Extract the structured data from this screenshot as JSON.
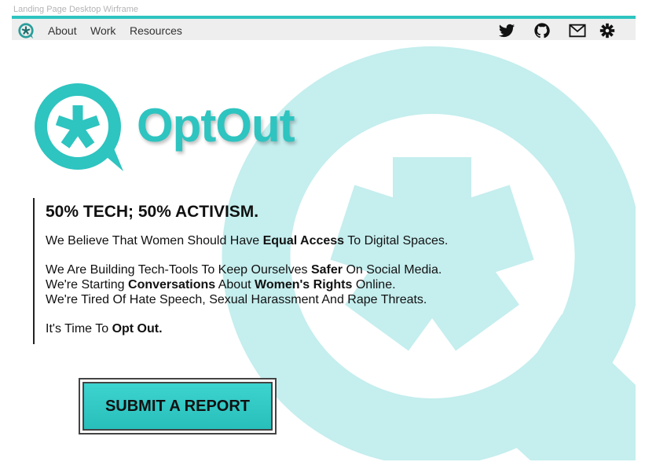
{
  "frame_title": "Landing Page Desktop Wirframe",
  "colors": {
    "accent": "#2ec4c0",
    "accent_light": "#c5eeee",
    "nav_bg": "#eeeeee"
  },
  "nav": {
    "logo_icon": "optout-logo-icon",
    "items": [
      {
        "label": "About"
      },
      {
        "label": "Work"
      },
      {
        "label": "Resources"
      }
    ],
    "icons": [
      "twitter-icon",
      "github-icon",
      "mail-icon",
      "settings-icon"
    ]
  },
  "hero": {
    "brand_name": "OptOut",
    "headline": "50% TECH; 50% ACTIVISM.",
    "line1": {
      "a": "We Believe That Women Should Have ",
      "b": "Equal Access",
      "c": " To Digital Spaces."
    },
    "line2": {
      "a": "We Are Building Tech-Tools To Keep Ourselves ",
      "b": "Safer",
      "c": " On Social Media."
    },
    "line3": {
      "a": "We're Starting ",
      "b": "Conversations",
      "c": " About ",
      "d": "Women's Rights",
      "e": " Online."
    },
    "line4": "We're Tired Of Hate Speech, Sexual Harassment And Rape Threats.",
    "line5": {
      "a": "It's Time To ",
      "b": "Opt Out."
    }
  },
  "cta": {
    "label": "SUBMIT A REPORT"
  }
}
